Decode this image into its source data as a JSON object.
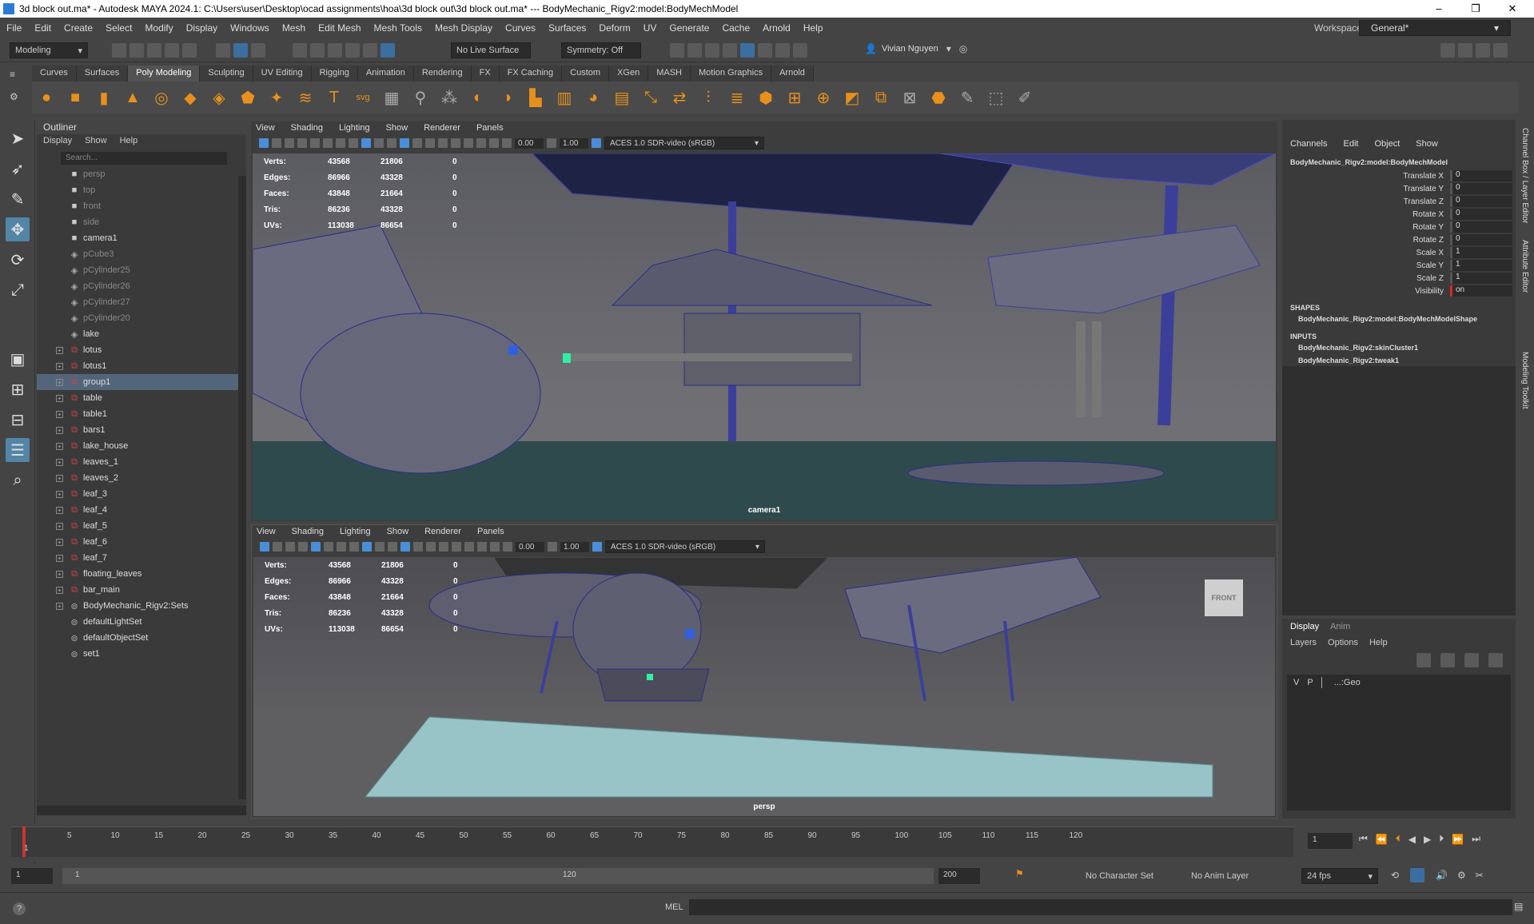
{
  "window": {
    "title": "3d block out.ma* - Autodesk MAYA 2024.1: C:\\Users\\user\\Desktop\\ocad assignments\\hoa\\3d block out\\3d block out.ma*  ---  BodyMechanic_Rigv2:model:BodyMechModel"
  },
  "menubar": {
    "items": [
      "File",
      "Edit",
      "Create",
      "Select",
      "Modify",
      "Display",
      "Windows",
      "Mesh",
      "Edit Mesh",
      "Mesh Tools",
      "Mesh Display",
      "Curves",
      "Surfaces",
      "Deform",
      "UV",
      "Generate",
      "Cache",
      "Arnold",
      "Help"
    ],
    "workspace_label": "Workspace:",
    "workspace_value": "General*"
  },
  "statusline": {
    "mode": "Modeling",
    "live_surface": "No Live Surface",
    "symmetry": "Symmetry: Off",
    "user": "Vivian Nguyen"
  },
  "shelf": {
    "tabs": [
      "Curves",
      "Surfaces",
      "Poly Modeling",
      "Sculpting",
      "UV Editing",
      "Rigging",
      "Animation",
      "Rendering",
      "FX",
      "FX Caching",
      "Custom",
      "XGen",
      "MASH",
      "Motion Graphics",
      "Arnold"
    ],
    "active_tab": "Poly Modeling"
  },
  "outliner": {
    "title": "Outliner",
    "menu": [
      "Display",
      "Show",
      "Help"
    ],
    "search_placeholder": "Search...",
    "items": [
      {
        "label": "persp",
        "icon": "camera-icon",
        "dim": true,
        "expand": false
      },
      {
        "label": "top",
        "icon": "camera-icon",
        "dim": true,
        "expand": false
      },
      {
        "label": "front",
        "icon": "camera-icon",
        "dim": true,
        "expand": false
      },
      {
        "label": "side",
        "icon": "camera-icon",
        "dim": true,
        "expand": false
      },
      {
        "label": "camera1",
        "icon": "camera-icon",
        "dim": false,
        "expand": false
      },
      {
        "label": "pCube3",
        "icon": "mesh-icon",
        "dim": true,
        "expand": false
      },
      {
        "label": "pCylinder25",
        "icon": "mesh-icon",
        "dim": true,
        "expand": false
      },
      {
        "label": "pCylinder26",
        "icon": "mesh-icon",
        "dim": true,
        "expand": false
      },
      {
        "label": "pCylinder27",
        "icon": "mesh-icon",
        "dim": true,
        "expand": false
      },
      {
        "label": "pCylinder20",
        "icon": "mesh-icon",
        "dim": true,
        "expand": false
      },
      {
        "label": "lake",
        "icon": "mesh-icon",
        "dim": false,
        "expand": false
      },
      {
        "label": "lotus",
        "icon": "group-icon",
        "dim": false,
        "expand": true
      },
      {
        "label": "lotus1",
        "icon": "group-icon",
        "dim": false,
        "expand": true
      },
      {
        "label": "group1",
        "icon": "group-icon",
        "dim": false,
        "expand": true,
        "selected": true
      },
      {
        "label": "table",
        "icon": "group-icon",
        "dim": false,
        "expand": true
      },
      {
        "label": "table1",
        "icon": "group-icon",
        "dim": false,
        "expand": true
      },
      {
        "label": "bars1",
        "icon": "group-icon",
        "dim": false,
        "expand": true
      },
      {
        "label": "lake_house",
        "icon": "group-icon",
        "dim": false,
        "expand": true
      },
      {
        "label": "leaves_1",
        "icon": "group-icon",
        "dim": false,
        "expand": true
      },
      {
        "label": "leaves_2",
        "icon": "group-icon",
        "dim": false,
        "expand": true
      },
      {
        "label": "leaf_3",
        "icon": "group-icon",
        "dim": false,
        "expand": true
      },
      {
        "label": "leaf_4",
        "icon": "group-icon",
        "dim": false,
        "expand": true
      },
      {
        "label": "leaf_5",
        "icon": "group-icon",
        "dim": false,
        "expand": true
      },
      {
        "label": "leaf_6",
        "icon": "group-icon",
        "dim": false,
        "expand": true
      },
      {
        "label": "leaf_7",
        "icon": "group-icon",
        "dim": false,
        "expand": true
      },
      {
        "label": "floating_leaves",
        "icon": "group-icon",
        "dim": false,
        "expand": true
      },
      {
        "label": "bar_main",
        "icon": "group-icon",
        "dim": false,
        "expand": true
      },
      {
        "label": "BodyMechanic_Rigv2:Sets",
        "icon": "set-icon",
        "dim": false,
        "expand": true
      },
      {
        "label": "defaultLightSet",
        "icon": "set-icon",
        "dim": false,
        "expand": false
      },
      {
        "label": "defaultObjectSet",
        "icon": "set-icon",
        "dim": false,
        "expand": false
      },
      {
        "label": "set1",
        "icon": "set-icon",
        "dim": false,
        "expand": false
      }
    ]
  },
  "viewport": {
    "menu": [
      "View",
      "Shading",
      "Lighting",
      "Show",
      "Renderer",
      "Panels"
    ],
    "value_a": "0.00",
    "value_b": "1.00",
    "colorspace": "ACES 1.0 SDR-video (sRGB)",
    "hud": [
      {
        "k": "Verts:",
        "a": "43568",
        "b": "21806",
        "c": "0"
      },
      {
        "k": "Edges:",
        "a": "86966",
        "b": "43328",
        "c": "0"
      },
      {
        "k": "Faces:",
        "a": "43848",
        "b": "21664",
        "c": "0"
      },
      {
        "k": "Tris:",
        "a": "86236",
        "b": "43328",
        "c": "0"
      },
      {
        "k": "UVs:",
        "a": "113038",
        "b": "86654",
        "c": "0"
      }
    ],
    "top_camera": "camera1",
    "bottom_camera": "persp",
    "viewcube": "FRONT"
  },
  "channelbox": {
    "menu": [
      "Channels",
      "Edit",
      "Object",
      "Show"
    ],
    "object": "BodyMechanic_Rigv2:model:BodyMechModel",
    "attrs": [
      {
        "n": "Translate X",
        "v": "0"
      },
      {
        "n": "Translate Y",
        "v": "0"
      },
      {
        "n": "Translate Z",
        "v": "0"
      },
      {
        "n": "Rotate X",
        "v": "0"
      },
      {
        "n": "Rotate Y",
        "v": "0"
      },
      {
        "n": "Rotate Z",
        "v": "0"
      },
      {
        "n": "Scale X",
        "v": "1"
      },
      {
        "n": "Scale Y",
        "v": "1"
      },
      {
        "n": "Scale Z",
        "v": "1"
      },
      {
        "n": "Visibility",
        "v": "on"
      }
    ],
    "shapes_label": "SHAPES",
    "shape": "BodyMechanic_Rigv2:model:BodyMechModelShape",
    "inputs_label": "INPUTS",
    "inputs": [
      "BodyMechanic_Rigv2:skinCluster1",
      "BodyMechanic_Rigv2:tweak1"
    ]
  },
  "layers": {
    "tabs": [
      "Display",
      "Anim"
    ],
    "menu": [
      "Layers",
      "Options",
      "Help"
    ],
    "row": {
      "v": "V",
      "p": "P",
      "name": "...:Geo"
    }
  },
  "sidetabs": [
    "Channel Box / Layer Editor",
    "Attribute Editor",
    "Modeling Toolkit"
  ],
  "timeslider": {
    "ticks": [
      "5",
      "10",
      "15",
      "20",
      "25",
      "30",
      "35",
      "40",
      "45",
      "50",
      "55",
      "60",
      "65",
      "70",
      "75",
      "80",
      "85",
      "90",
      "95",
      "100",
      "105",
      "110",
      "115",
      "120"
    ],
    "start_tick": "1",
    "current_frame": "1"
  },
  "range": {
    "start": "1",
    "inner_start": "1",
    "inner_end": "120",
    "end": "200",
    "character_set": "No Character Set",
    "anim_layer": "No Anim Layer",
    "fps": "24 fps"
  },
  "cmdline": {
    "label": "MEL"
  }
}
